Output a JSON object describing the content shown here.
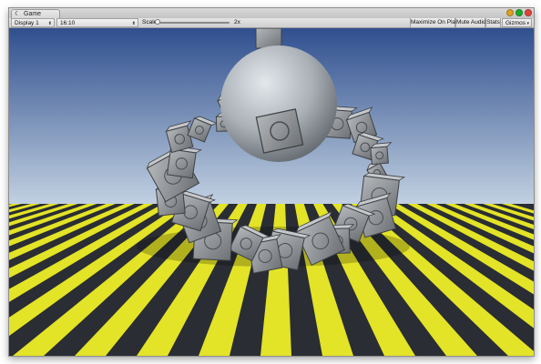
{
  "window": {
    "tab_icon": "game-controller-icon",
    "tab_label": "Game"
  },
  "toolbar": {
    "display_label": "Display 1",
    "aspect_label": "16:10",
    "scale_label": "Scale",
    "scale_value_label": "2x",
    "scale_level": 0.0,
    "maximize_label": "Maximize On Play",
    "mute_label": "Mute Audio",
    "stats_label": "Stats",
    "gizmos_label": "Gizmos"
  },
  "colors": {
    "sky_top": "#2f4f8e",
    "sky_bottom": "#c3d2e2",
    "stripe_yellow": "#e3e327",
    "stripe_dark": "#2a2d33",
    "crate": "#8e9296",
    "sphere": "#b9c0c6",
    "close_button": "#e0443e",
    "minimize_button": "#dea123",
    "zoom_button": "#1aab29"
  }
}
